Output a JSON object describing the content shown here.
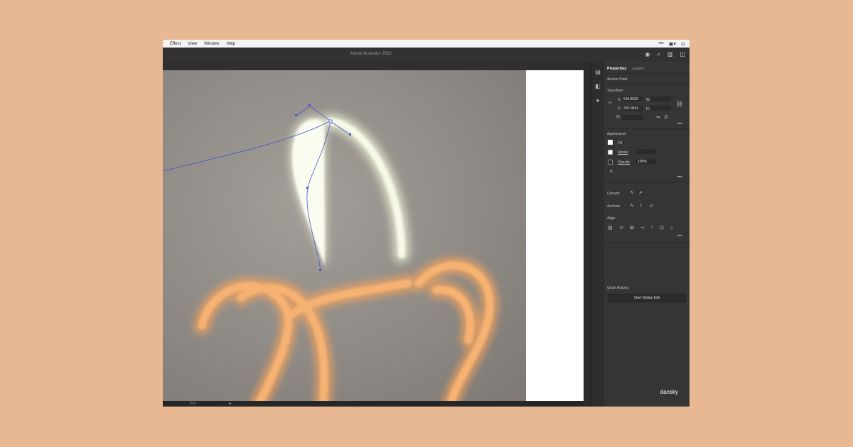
{
  "menubar": {
    "items": [
      "Effect",
      "View",
      "Window",
      "Help"
    ],
    "right_icons": [
      "more-icon",
      "save-icon",
      "clock-icon"
    ]
  },
  "titlebar": {
    "title": "Adobe Illustrator 2022",
    "icons": [
      "user-icon",
      "search-icon",
      "arrange-icon",
      "panel-icon"
    ]
  },
  "statusbar": {
    "tool": "Pen",
    "arrow": "▶"
  },
  "panel": {
    "tabs": [
      "Properties",
      "Layers"
    ],
    "selection": "Anchor Point",
    "transform": {
      "heading": "Transform",
      "x_label": "X:",
      "x_value": "504.8336",
      "y_label": "Y:",
      "y_value": "250.0844",
      "w_label": "W:",
      "h_label": "H:"
    },
    "appearance": {
      "heading": "Appearance",
      "fill_label": "Fill",
      "stroke_label": "Stroke",
      "opacity_label": "Opacity",
      "opacity_value": "100%",
      "fx_label": "fx."
    },
    "convert_label": "Convert",
    "anchors_label": "Anchors",
    "align_label": "Align",
    "quick_actions": {
      "heading": "Quick Actions",
      "button": "Start Global Edit"
    }
  },
  "brand": "dansky",
  "colors": {
    "background": "#e8b892",
    "neon_white": "#f4f6e6",
    "neon_orange": "#f0a25e",
    "path": "#3b4db8"
  }
}
